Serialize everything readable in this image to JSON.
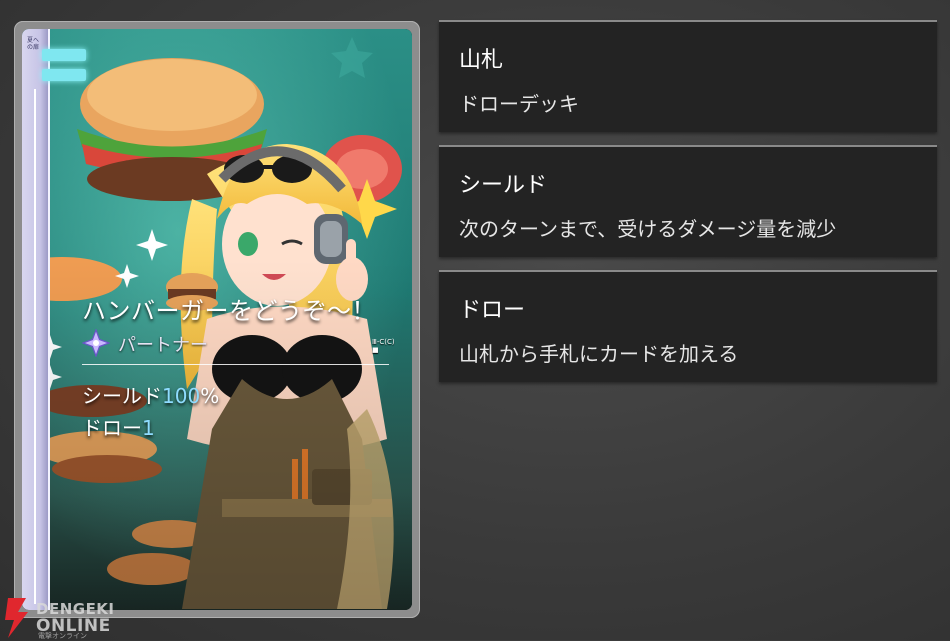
{
  "card": {
    "title": "ハンバーガーをどうぞ～！",
    "type_label": "パートナー",
    "code": "Ⅲ-C(C) ■",
    "side_text": "夏への扉",
    "stats": {
      "shield_label": "シールド",
      "shield_value": "100",
      "shield_unit": "%",
      "draw_label": "ドロー",
      "draw_value": "1"
    },
    "accent_color": "#8fdcff"
  },
  "glossary": [
    {
      "term": "山札",
      "description": "ドローデッキ"
    },
    {
      "term": "シールド",
      "description": "次のターンまで、受けるダメージ量を減少"
    },
    {
      "term": "ドロー",
      "description": "山札から手札にカードを加える"
    }
  ],
  "watermark": {
    "line1": "DENGEKI",
    "line2": "ONLINE",
    "line3": "電撃オンライン"
  }
}
